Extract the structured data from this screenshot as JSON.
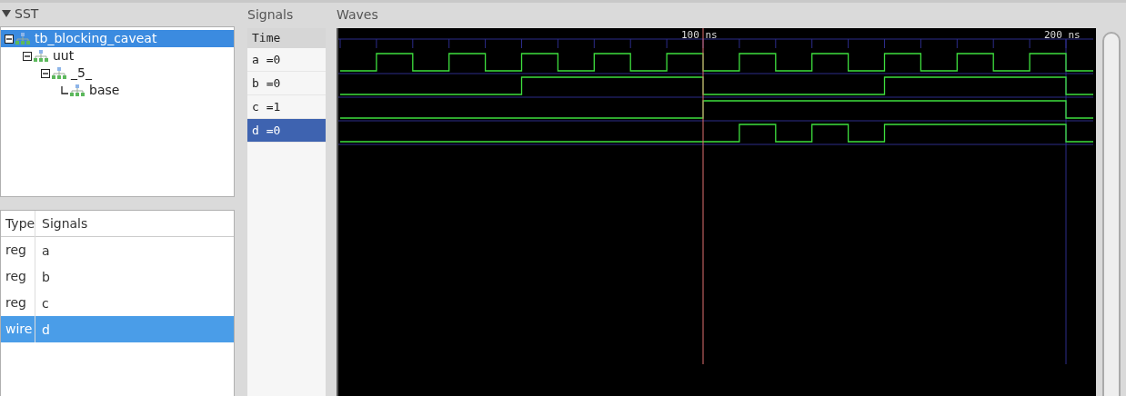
{
  "sst": {
    "title": "SST",
    "expanded": true,
    "tree": [
      {
        "label": "tb_blocking_caveat",
        "selected": true,
        "expanded": true,
        "children": [
          {
            "label": "uut",
            "selected": false,
            "expanded": true,
            "children": [
              {
                "label": "_5_",
                "selected": false,
                "expanded": true,
                "children": [
                  {
                    "label": "base",
                    "selected": false
                  }
                ]
              }
            ]
          }
        ]
      }
    ]
  },
  "signal_table": {
    "columns": [
      "Type",
      "Signals"
    ],
    "rows": [
      {
        "type": "reg",
        "signal": "a",
        "selected": false
      },
      {
        "type": "reg",
        "signal": "b",
        "selected": false
      },
      {
        "type": "reg",
        "signal": "c",
        "selected": false
      },
      {
        "type": "wire",
        "signal": "d",
        "selected": true
      }
    ]
  },
  "signals_panel": {
    "title": "Signals",
    "header": "Time",
    "items": [
      {
        "label": "a =0",
        "selected": false
      },
      {
        "label": "b =0",
        "selected": false
      },
      {
        "label": "c =1",
        "selected": false
      },
      {
        "label": "d =0",
        "selected": true
      }
    ]
  },
  "waves": {
    "title": "Waves",
    "time_labels": [
      "100 ns",
      "200 ns"
    ]
  }
}
